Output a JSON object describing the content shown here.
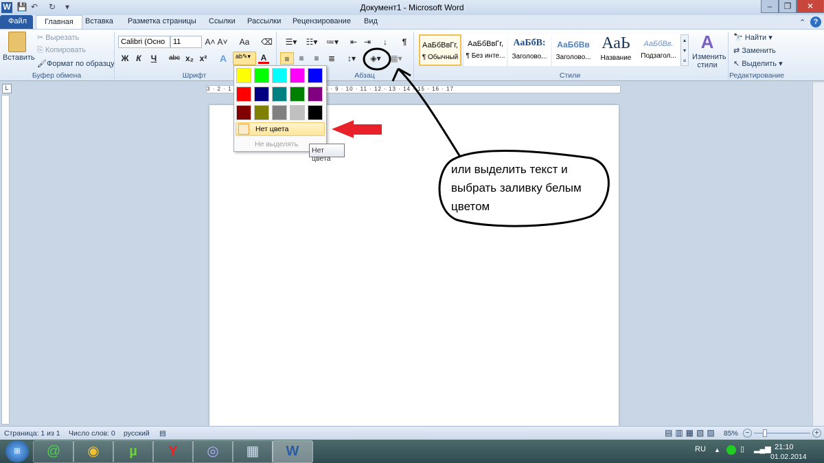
{
  "window": {
    "title": "Документ1 - Microsoft Word",
    "minimize": "–",
    "restore": "❐",
    "close": "✕"
  },
  "qat": {
    "word_icon": "W",
    "save": "💾",
    "undo": "↶",
    "redo": "↻",
    "customize": "▾"
  },
  "tabs": [
    "Файл",
    "Главная",
    "Вставка",
    "Разметка страницы",
    "Ссылки",
    "Рассылки",
    "Рецензирование",
    "Вид"
  ],
  "clipboard": {
    "paste": "Вставить",
    "cut": "Вырезать",
    "copy": "Копировать",
    "format_painter": "Формат по образцу",
    "label": "Буфер обмена"
  },
  "font": {
    "name": "Calibri (Осно",
    "size": "11",
    "bold": "Ж",
    "italic": "К",
    "underline": "Ч",
    "strike": "abc",
    "sub": "x₂",
    "sup": "x²",
    "grow": "A˄",
    "shrink": "A˅",
    "case": "Aa",
    "label": "Шрифт"
  },
  "paragraph": {
    "label": "Абзац",
    "show_marks": "¶"
  },
  "styles": {
    "items": [
      {
        "preview": "АаБбВвГг,",
        "name": "¶ Обычный"
      },
      {
        "preview": "АаБбВвГг,",
        "name": "¶ Без инте..."
      },
      {
        "preview": "АаБбВ:",
        "name": "Заголово..."
      },
      {
        "preview": "АаБбВв",
        "name": "Заголово..."
      },
      {
        "preview": "АаЬ",
        "name": "Название"
      },
      {
        "preview": "АаБбВв.",
        "name": "Подзагол..."
      }
    ],
    "change": "Изменить стили",
    "label": "Стили"
  },
  "editing": {
    "find": "Найти",
    "replace": "Заменить",
    "select": "Выделить",
    "label": "Редактирование"
  },
  "highlight_menu": {
    "colors": [
      "#ffff00",
      "#00ff00",
      "#00ffff",
      "#ff00ff",
      "#0000ff",
      "#ff0000",
      "#000080",
      "#008080",
      "#008000",
      "#800080",
      "#800000",
      "#808000",
      "#808080",
      "#c0c0c0",
      "#000000"
    ],
    "no_color": "Нет цвета",
    "stop": "Не выделять",
    "tooltip": "Нет цвета"
  },
  "annotation": {
    "text": "или выделить текст и выбрать заливку белым цветом"
  },
  "ruler": {
    "marks": "3 · 2 · 1 · ⌂ · 1 · 2 · 3 · 4 · 5 · 6 · 7 · 8 · 9 · 10 · 11 · 12 · 13 · 14 · 15 · 16 · 17"
  },
  "status": {
    "page": "Страница: 1 из 1",
    "words": "Число слов: 0",
    "lang": "русский",
    "zoom": "85%",
    "zoom_percent": 85
  },
  "taskbar": {
    "lang": "RU",
    "time": "21:10",
    "date": "01.02.2014"
  }
}
